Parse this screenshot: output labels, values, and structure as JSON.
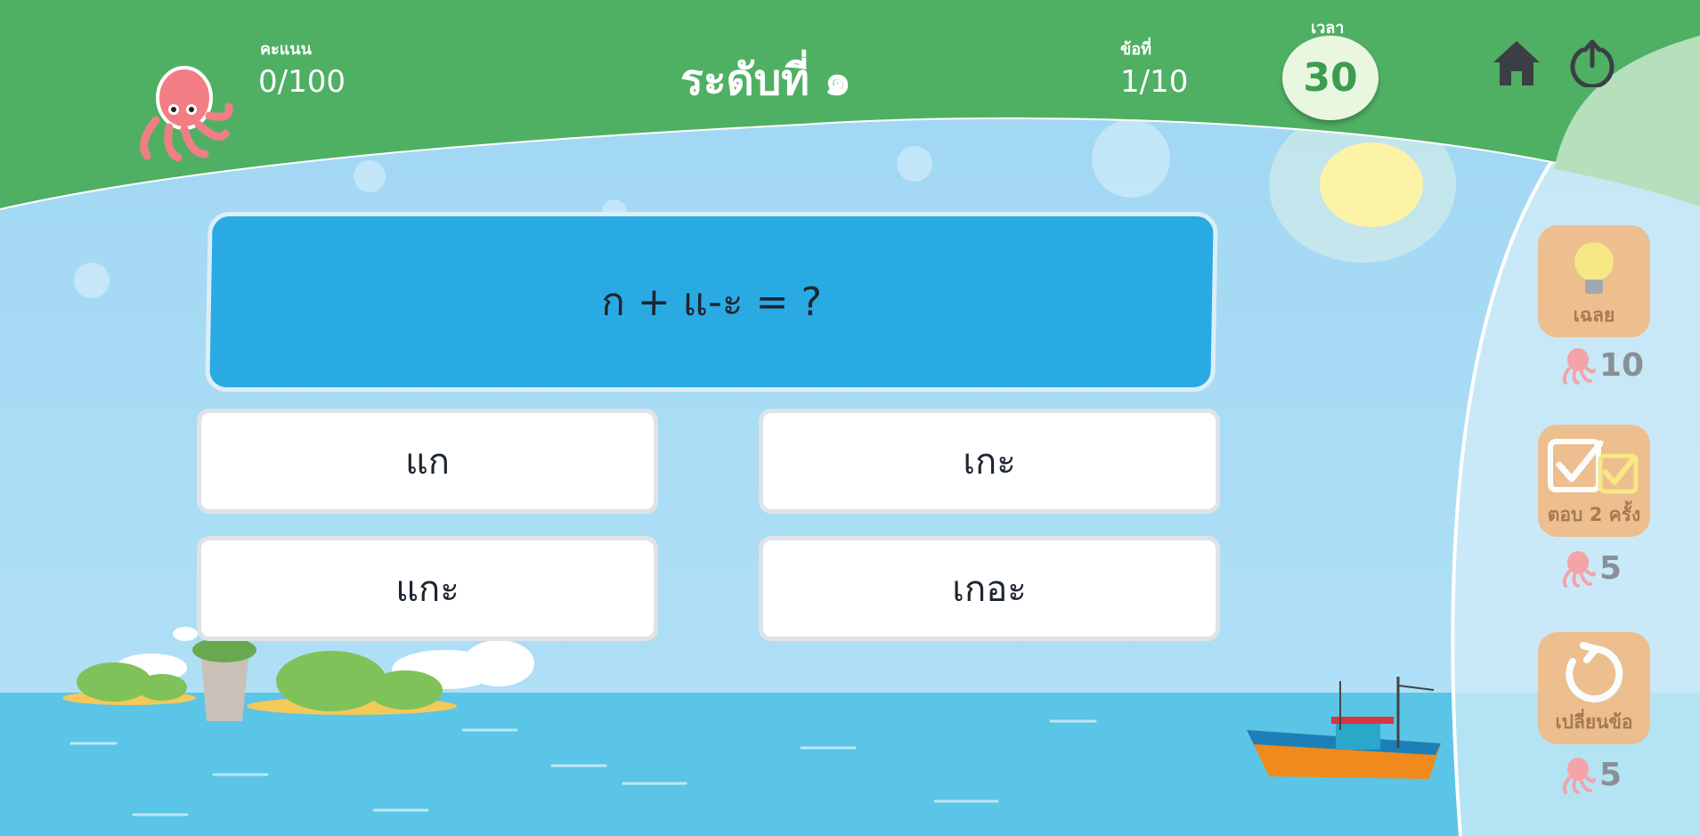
{
  "hud": {
    "score_label": "คะแนน",
    "score_value": "0/100",
    "level_title": "ระดับที่ ๑",
    "question_label": "ข้อที่",
    "question_value": "1/10",
    "timer_label": "เวลา",
    "timer_value": "30"
  },
  "question": {
    "text": "ก + แ-ะ = ?"
  },
  "answers": [
    {
      "label": "แก"
    },
    {
      "label": "เกะ"
    },
    {
      "label": "แกะ"
    },
    {
      "label": "เกอะ"
    }
  ],
  "powerups": [
    {
      "label": "เฉลย",
      "cost": "10",
      "icon": "lightbulb-icon"
    },
    {
      "label": "ตอบ 2 ครั้ง",
      "cost": "5",
      "icon": "double-check-icon"
    },
    {
      "label": "เปลี่ยนข้อ",
      "cost": "5",
      "icon": "refresh-icon"
    }
  ],
  "colors": {
    "header_green": "#4fb064",
    "question_blue": "#2aaae3",
    "powerup_orange": "#f1bb86",
    "sea": "#5ac5e6"
  }
}
